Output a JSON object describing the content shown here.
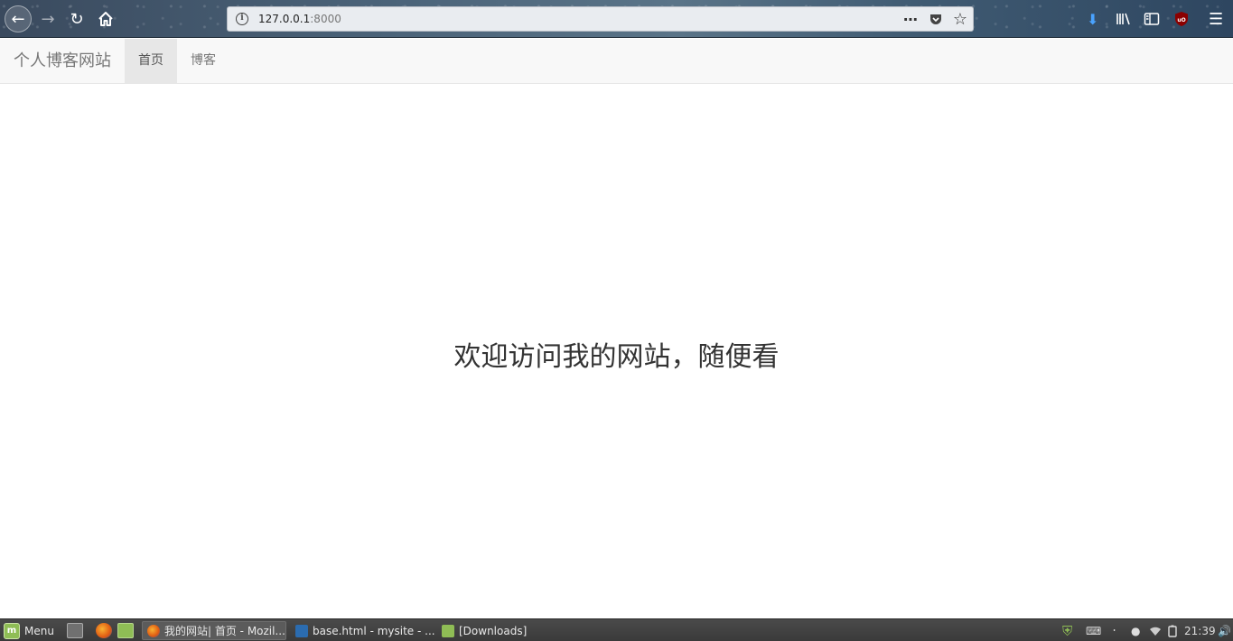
{
  "browser": {
    "url_host": "127.0.0.1",
    "url_port": ":8000",
    "icons": [
      "back-icon",
      "forward-icon",
      "reload-icon",
      "home-icon",
      "info-icon",
      "page-actions-icon",
      "pocket-icon",
      "bookmark-star-icon",
      "download-icon",
      "library-icon",
      "sidebar-icon",
      "ublock-icon",
      "hamburger-menu-icon"
    ],
    "ublock_label": "uO"
  },
  "site": {
    "brand": "个人博客网站",
    "nav": [
      {
        "label": "首页",
        "active": true
      },
      {
        "label": "博客",
        "active": false
      }
    ],
    "welcome": "欢迎访问我的网站，随便看"
  },
  "taskbar": {
    "menu_label": "Menu",
    "tasks": [
      {
        "label": "我的网站| 首页 - Mozil...",
        "active": true
      },
      {
        "label": "base.html - mysite - ...",
        "active": false
      },
      {
        "label": "[Downloads]",
        "active": false
      }
    ],
    "clock": "21:39"
  },
  "colors": {
    "navbar_bg": "#f8f8f8",
    "active_nav_bg": "#e7e7e7",
    "taskbar_bg": "#3a3a3a",
    "mint_green": "#8fbd55"
  }
}
